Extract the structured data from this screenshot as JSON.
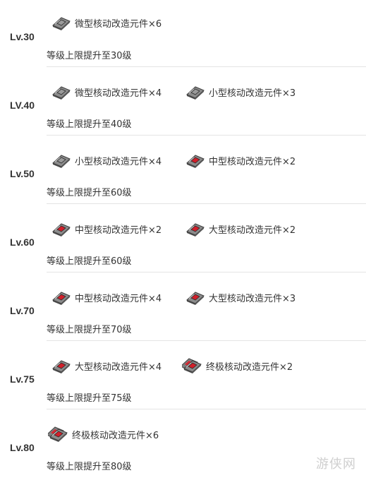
{
  "rows": [
    {
      "level": "Lv.30",
      "items": [
        {
          "label": "微型核动改造元件×6",
          "icon": "micro-core-icon",
          "tier": "micro"
        }
      ],
      "desc": "等级上限提升至30级"
    },
    {
      "level": "LV.40",
      "items": [
        {
          "label": "微型核动改造元件×4",
          "icon": "micro-core-icon",
          "tier": "micro"
        },
        {
          "label": "小型核动改造元件×3",
          "icon": "small-core-icon",
          "tier": "small"
        }
      ],
      "desc": "等级上限提升至40级"
    },
    {
      "level": "Lv.50",
      "items": [
        {
          "label": "小型核动改造元件×4",
          "icon": "small-core-icon",
          "tier": "small"
        },
        {
          "label": "中型核动改造元件×2",
          "icon": "medium-core-icon",
          "tier": "medium"
        }
      ],
      "desc": "等级上限提升至60级"
    },
    {
      "level": "Lv.60",
      "items": [
        {
          "label": "中型核动改造元件×2",
          "icon": "medium-core-icon",
          "tier": "medium"
        },
        {
          "label": "大型核动改造元件×2",
          "icon": "large-core-icon",
          "tier": "large"
        }
      ],
      "desc": "等级上限提升至60级"
    },
    {
      "level": "Lv.70",
      "items": [
        {
          "label": "中型核动改造元件×4",
          "icon": "medium-core-icon",
          "tier": "medium"
        },
        {
          "label": "大型核动改造元件×3",
          "icon": "large-core-icon",
          "tier": "large"
        }
      ],
      "desc": "等级上限提升至70级"
    },
    {
      "level": "Lv.75",
      "items": [
        {
          "label": "大型核动改造元件×4",
          "icon": "large-core-icon",
          "tier": "large"
        },
        {
          "label": "终极核动改造元件×2",
          "icon": "ultimate-core-icon",
          "tier": "ultimate"
        }
      ],
      "desc": "等级上限提升至75级"
    },
    {
      "level": "Lv.80",
      "items": [
        {
          "label": "终极核动改造元件×6",
          "icon": "ultimate-core-icon",
          "tier": "ultimate"
        }
      ],
      "desc": "等级上限提升至80级"
    }
  ],
  "watermark": "游侠网",
  "colors": {
    "text": "#333333",
    "separator": "#e4e4e4",
    "metal": "#6b6b6b",
    "accent_red": "#d21f2a"
  }
}
